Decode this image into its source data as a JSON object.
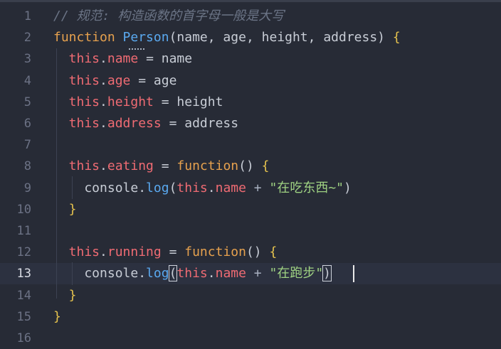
{
  "editor": {
    "lines": [
      {
        "num": "1",
        "tokens": [
          {
            "t": "// 规范: 构造函数的首字母一般是大写",
            "c": "cmt"
          }
        ]
      },
      {
        "num": "2",
        "tokens": [
          {
            "t": "function",
            "c": "kw"
          },
          {
            "t": " ",
            "c": ""
          },
          {
            "t": "Person",
            "c": "fnname"
          },
          {
            "t": "(name, age, height, address) ",
            "c": "punc"
          },
          {
            "t": "{",
            "c": "brace"
          }
        ]
      },
      {
        "num": "3",
        "tokens": [
          {
            "t": "  this",
            "c": "this"
          },
          {
            "t": ".",
            "c": "punc"
          },
          {
            "t": "name",
            "c": "prop"
          },
          {
            "t": " = name",
            "c": "punc"
          }
        ]
      },
      {
        "num": "4",
        "tokens": [
          {
            "t": "  this",
            "c": "this"
          },
          {
            "t": ".",
            "c": "punc"
          },
          {
            "t": "age",
            "c": "prop"
          },
          {
            "t": " = age",
            "c": "punc"
          }
        ]
      },
      {
        "num": "5",
        "tokens": [
          {
            "t": "  this",
            "c": "this"
          },
          {
            "t": ".",
            "c": "punc"
          },
          {
            "t": "height",
            "c": "prop"
          },
          {
            "t": " = height",
            "c": "punc"
          }
        ]
      },
      {
        "num": "6",
        "tokens": [
          {
            "t": "  this",
            "c": "this"
          },
          {
            "t": ".",
            "c": "punc"
          },
          {
            "t": "address",
            "c": "prop"
          },
          {
            "t": " = address",
            "c": "punc"
          }
        ]
      },
      {
        "num": "7",
        "tokens": []
      },
      {
        "num": "8",
        "tokens": [
          {
            "t": "  this",
            "c": "this"
          },
          {
            "t": ".",
            "c": "punc"
          },
          {
            "t": "eating",
            "c": "prop"
          },
          {
            "t": " = ",
            "c": "punc"
          },
          {
            "t": "function",
            "c": "kw"
          },
          {
            "t": "() ",
            "c": "punc"
          },
          {
            "t": "{",
            "c": "brace"
          }
        ]
      },
      {
        "num": "9",
        "tokens": [
          {
            "t": "    console.",
            "c": "punc"
          },
          {
            "t": "log",
            "c": "fn"
          },
          {
            "t": "(",
            "c": "punc"
          },
          {
            "t": "this",
            "c": "this"
          },
          {
            "t": ".",
            "c": "punc"
          },
          {
            "t": "name",
            "c": "prop"
          },
          {
            "t": " + ",
            "c": "op"
          },
          {
            "t": "\"在吃东西~\"",
            "c": "str"
          },
          {
            "t": ")",
            "c": "punc"
          }
        ]
      },
      {
        "num": "10",
        "tokens": [
          {
            "t": "  }",
            "c": "brace"
          }
        ]
      },
      {
        "num": "11",
        "tokens": []
      },
      {
        "num": "12",
        "tokens": [
          {
            "t": "  this",
            "c": "this"
          },
          {
            "t": ".",
            "c": "punc"
          },
          {
            "t": "running",
            "c": "prop"
          },
          {
            "t": " = ",
            "c": "punc"
          },
          {
            "t": "function",
            "c": "kw"
          },
          {
            "t": "() ",
            "c": "punc"
          },
          {
            "t": "{",
            "c": "brace"
          }
        ]
      },
      {
        "num": "13",
        "active": true,
        "tokens": [
          {
            "t": "    console.",
            "c": "punc"
          },
          {
            "t": "log",
            "c": "fn"
          },
          {
            "t": "(",
            "c": "punc paren-hl"
          },
          {
            "t": "this",
            "c": "this"
          },
          {
            "t": ".",
            "c": "punc"
          },
          {
            "t": "name",
            "c": "prop"
          },
          {
            "t": " + ",
            "c": "op"
          },
          {
            "t": "\"在跑步\"",
            "c": "str"
          },
          {
            "t": ")",
            "c": "punc paren-hl"
          }
        ]
      },
      {
        "num": "14",
        "tokens": [
          {
            "t": "  }",
            "c": "brace"
          }
        ]
      },
      {
        "num": "15",
        "tokens": [
          {
            "t": "}",
            "c": "brace"
          }
        ]
      },
      {
        "num": "16",
        "tokens": []
      }
    ]
  }
}
